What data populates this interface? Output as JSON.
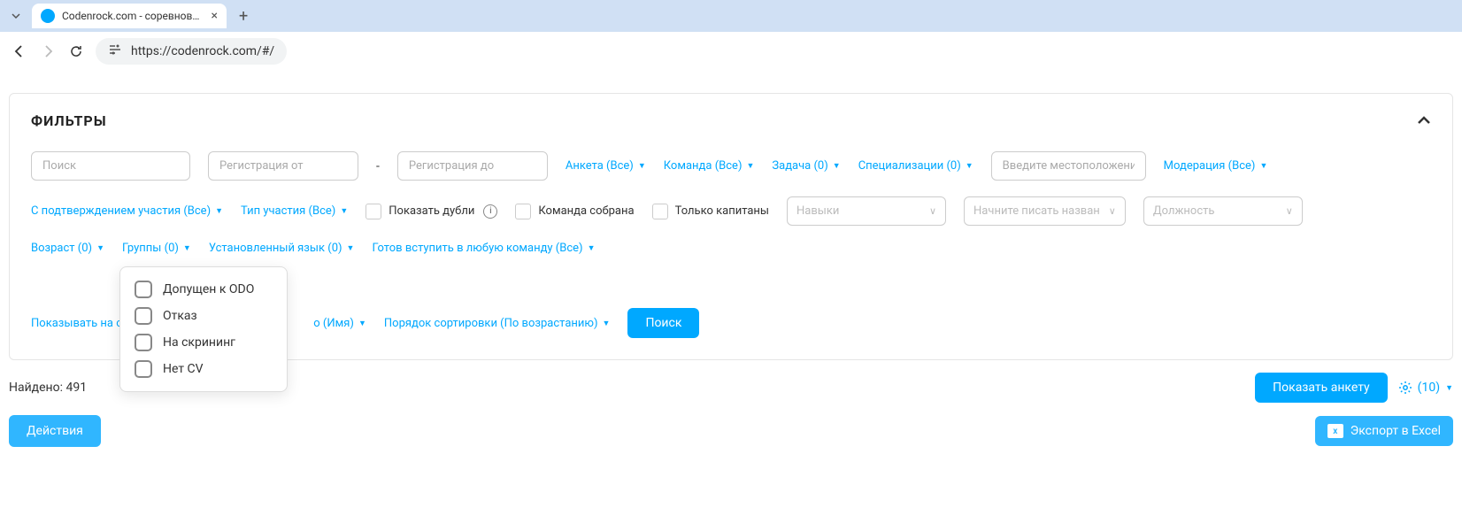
{
  "browser": {
    "tab_title": "Codenrock.com - соревновани",
    "url": "https://codenrock.com/#/"
  },
  "filters": {
    "title": "ФИЛЬТРЫ",
    "search_ph": "Поиск",
    "reg_from_ph": "Регистрация от",
    "reg_to_ph": "Регистрация до",
    "dash": "-",
    "anketa": "Анкета (Все)",
    "team": "Команда (Все)",
    "task": "Задача (0)",
    "specializations": "Специализации (0)",
    "location_ph": "Введите местоположение",
    "moderation": "Модерация (Все)",
    "confirm": "С подтверждением участия (Все)",
    "participation": "Тип участия (Все)",
    "show_dupes": "Показать дубли",
    "team_ready": "Команда собрана",
    "captains_only": "Только капитаны",
    "skills_ph": "Навыки",
    "company_ph": "Начните писать назван",
    "position_ph": "Должность",
    "age": "Возраст (0)",
    "groups": "Группы (0)",
    "language": "Установленный язык (0)",
    "any_team": "Готов вступить в любую команду (Все)",
    "per_page_prefix": "Показывать на ст",
    "sort_name": "о (Имя)",
    "sort_order": "Порядок сортировки (По возрастанию)",
    "search_btn": "Поиск"
  },
  "popup": {
    "items": [
      "Допущен к ODO",
      "Отказ",
      "На скрининг",
      "Нет CV"
    ]
  },
  "bottom": {
    "found_label": "Найдено: ",
    "found_count": "491",
    "show_anketa": "Показать анкету",
    "cols_count": "(10)",
    "actions": "Действия",
    "export": "Экспорт в Excel",
    "excel_glyph": "x"
  }
}
